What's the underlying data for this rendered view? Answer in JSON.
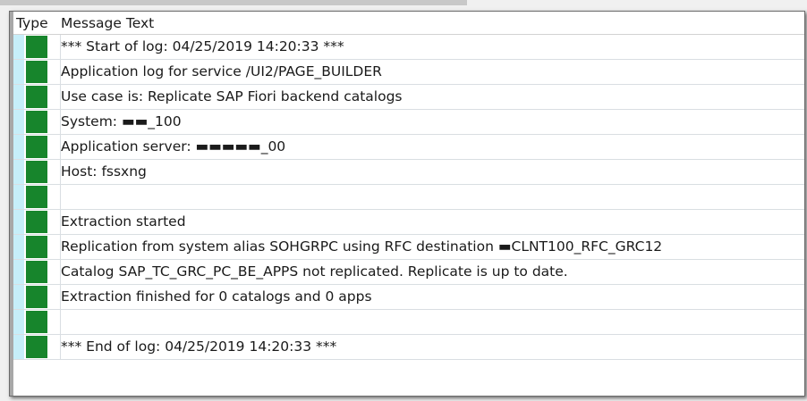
{
  "table": {
    "headers": {
      "type": "Type",
      "message": "Message Text"
    },
    "status_color": "#17852c",
    "rows": [
      {
        "status": "success",
        "message": "*** Start of log: 04/25/2019 14:20:33 ***"
      },
      {
        "status": "success",
        "message": "Application log for service /UI2/PAGE_BUILDER"
      },
      {
        "status": "success",
        "message": "Use case is: Replicate SAP Fiori backend catalogs"
      },
      {
        "status": "success",
        "message": "System: ▬▬_100"
      },
      {
        "status": "success",
        "message": "Application server: ▬▬▬▬▬_00"
      },
      {
        "status": "success",
        "message": "Host: fssxng"
      },
      {
        "status": "success",
        "message": ""
      },
      {
        "status": "success",
        "message": "Extraction started"
      },
      {
        "status": "success",
        "message": "Replication from system alias SOHGRPC using RFC destination ▬CLNT100_RFC_GRC12"
      },
      {
        "status": "success",
        "message": "Catalog SAP_TC_GRC_PC_BE_APPS not replicated. Replicate is up to date."
      },
      {
        "status": "success",
        "message": "Extraction finished for 0 catalogs and 0 apps"
      },
      {
        "status": "success",
        "message": ""
      },
      {
        "status": "success",
        "message": "*** End of log: 04/25/2019 14:20:33 ***"
      }
    ]
  }
}
